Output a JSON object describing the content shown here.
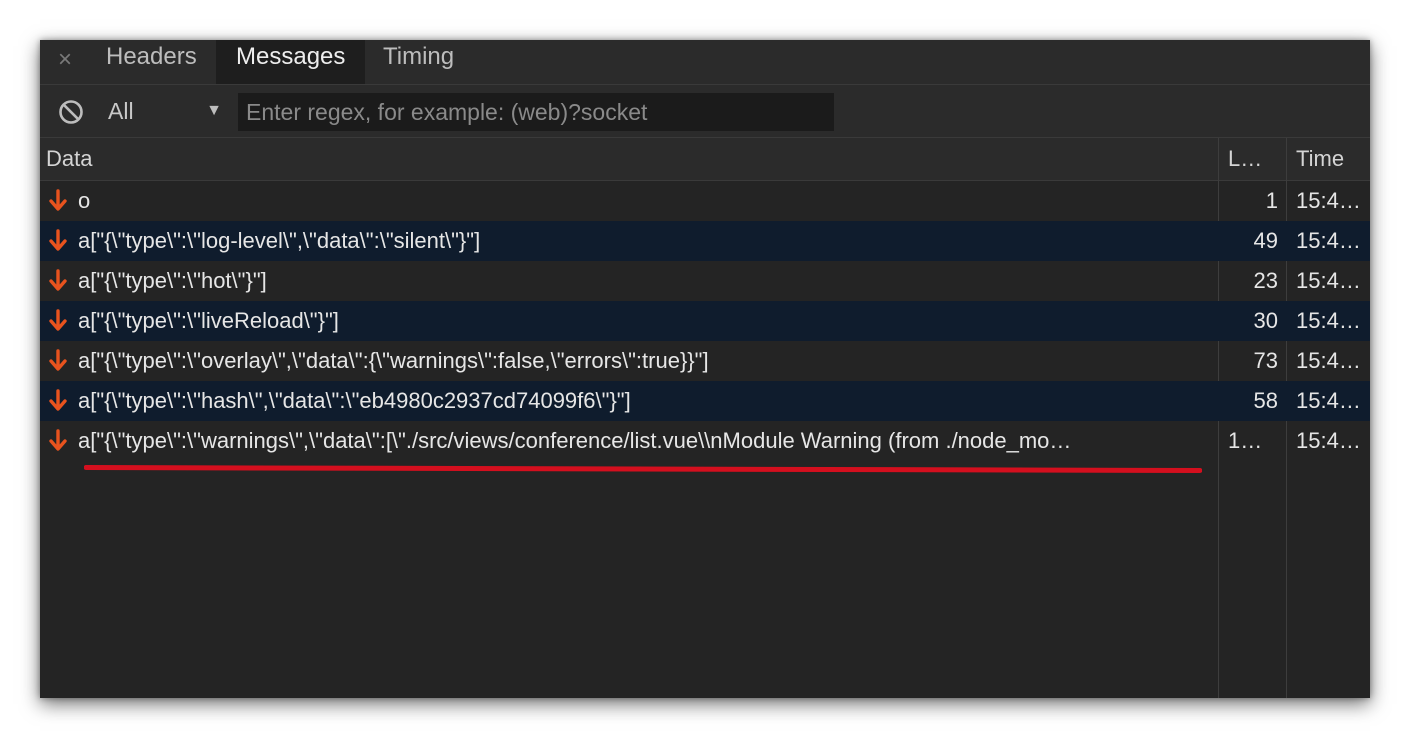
{
  "tabs": [
    {
      "label": "Headers",
      "active": false
    },
    {
      "label": "Messages",
      "active": true
    },
    {
      "label": "Timing",
      "active": false
    }
  ],
  "close_glyph": "×",
  "filter": {
    "selected": "All",
    "arrow_glyph": "▼",
    "regex_placeholder": "Enter regex, for example: (web)?socket",
    "regex_value": ""
  },
  "table": {
    "columns": {
      "data": "Data",
      "length": "L…",
      "time": "Time"
    },
    "rows": [
      {
        "data": "o",
        "length": "1",
        "time": "15:4…"
      },
      {
        "data": "a[\"{\\\"type\\\":\\\"log-level\\\",\\\"data\\\":\\\"silent\\\"}\"]",
        "length": "49",
        "time": "15:4…"
      },
      {
        "data": "a[\"{\\\"type\\\":\\\"hot\\\"}\"]",
        "length": "23",
        "time": "15:4…"
      },
      {
        "data": "a[\"{\\\"type\\\":\\\"liveReload\\\"}\"]",
        "length": "30",
        "time": "15:4…"
      },
      {
        "data": "a[\"{\\\"type\\\":\\\"overlay\\\",\\\"data\\\":{\\\"warnings\\\":false,\\\"errors\\\":true}}\"]",
        "length": "73",
        "time": "15:4…"
      },
      {
        "data": "a[\"{\\\"type\\\":\\\"hash\\\",\\\"data\\\":\\\"eb4980c2937cd74099f6\\\"}\"]",
        "length": "58",
        "time": "15:4…"
      },
      {
        "data": "a[\"{\\\"type\\\":\\\"warnings\\\",\\\"data\\\":[\\\"./src/views/conference/list.vue\\\\nModule Warning (from ./node_mo…",
        "length": "1…",
        "time": "15:4…"
      }
    ]
  },
  "colors": {
    "panel_bg": "#242424",
    "header_bg": "#2b2b2b",
    "alt_row_bg": "#0f1c2d",
    "received_arrow": "#e8531e",
    "annotation_underline": "#d40f1e"
  },
  "icons": {
    "close": "close-icon",
    "block": "block-icon",
    "received": "arrow-down-icon"
  }
}
